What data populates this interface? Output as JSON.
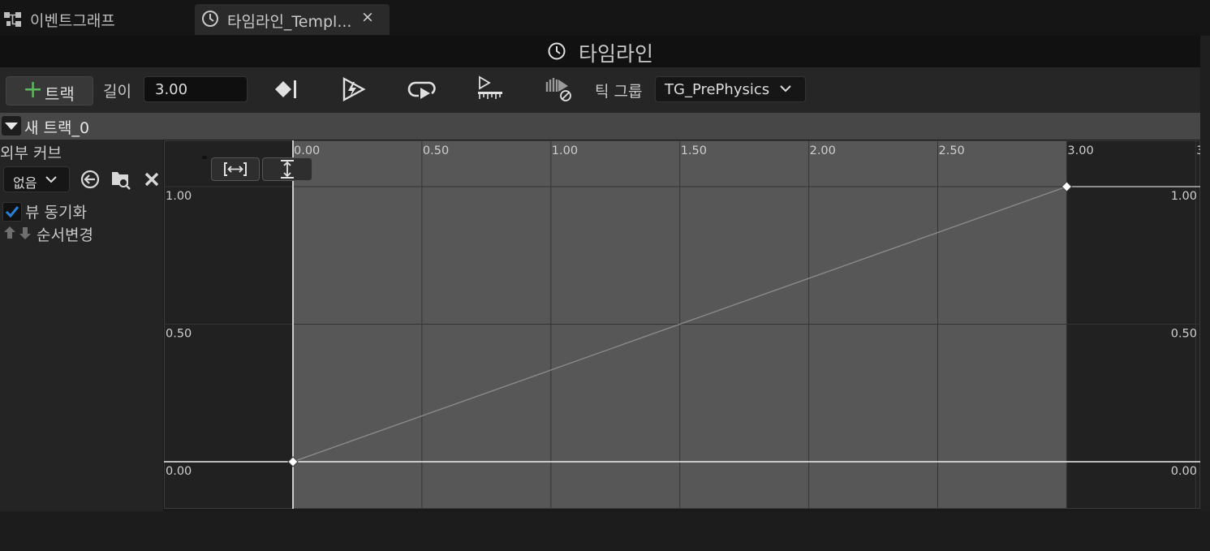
{
  "tabs": [
    {
      "label": "이벤트그래프",
      "icon": "graph-icon"
    },
    {
      "label": "타임라인_Templ...",
      "icon": "clock-icon",
      "close": "×"
    }
  ],
  "title": "타임라인",
  "toolbar": {
    "add_track_label": "트랙",
    "length_label": "길이",
    "length_value": "3.00",
    "tick_group_label": "틱 그룹",
    "tick_group_value": "TG_PrePhysics",
    "icons": [
      "autoplay-last-keyframe-icon",
      "autoplay-icon",
      "loop-icon",
      "replicated-icon",
      "ignore-time-dilation-icon"
    ]
  },
  "track": {
    "name": "새 트랙_0",
    "external_curve_label": "외부 커브",
    "curve_value": "없음",
    "sync_view_label": "뷰 동기화",
    "sync_view_checked": true,
    "reorder_label": "순서변경"
  },
  "chart_data": {
    "type": "line",
    "x_ticks": [
      "0.00",
      "0.50",
      "1.00",
      "1.50",
      "2.00",
      "2.50",
      "3.00",
      "3"
    ],
    "y_ticks": [
      "1.00",
      "0.50",
      "0.00"
    ],
    "x_range": [
      0,
      3.5
    ],
    "y_range": [
      0,
      1
    ],
    "length": 3.0,
    "keys": [
      {
        "x": 0.0,
        "y": 0.0
      },
      {
        "x": 3.0,
        "y": 1.0
      }
    ],
    "grid": true
  },
  "colors": {
    "accent_green": "#5cb85c",
    "checkbox_blue": "#2a7fd4",
    "active_region": "#575757",
    "inactive_region": "#212121"
  }
}
